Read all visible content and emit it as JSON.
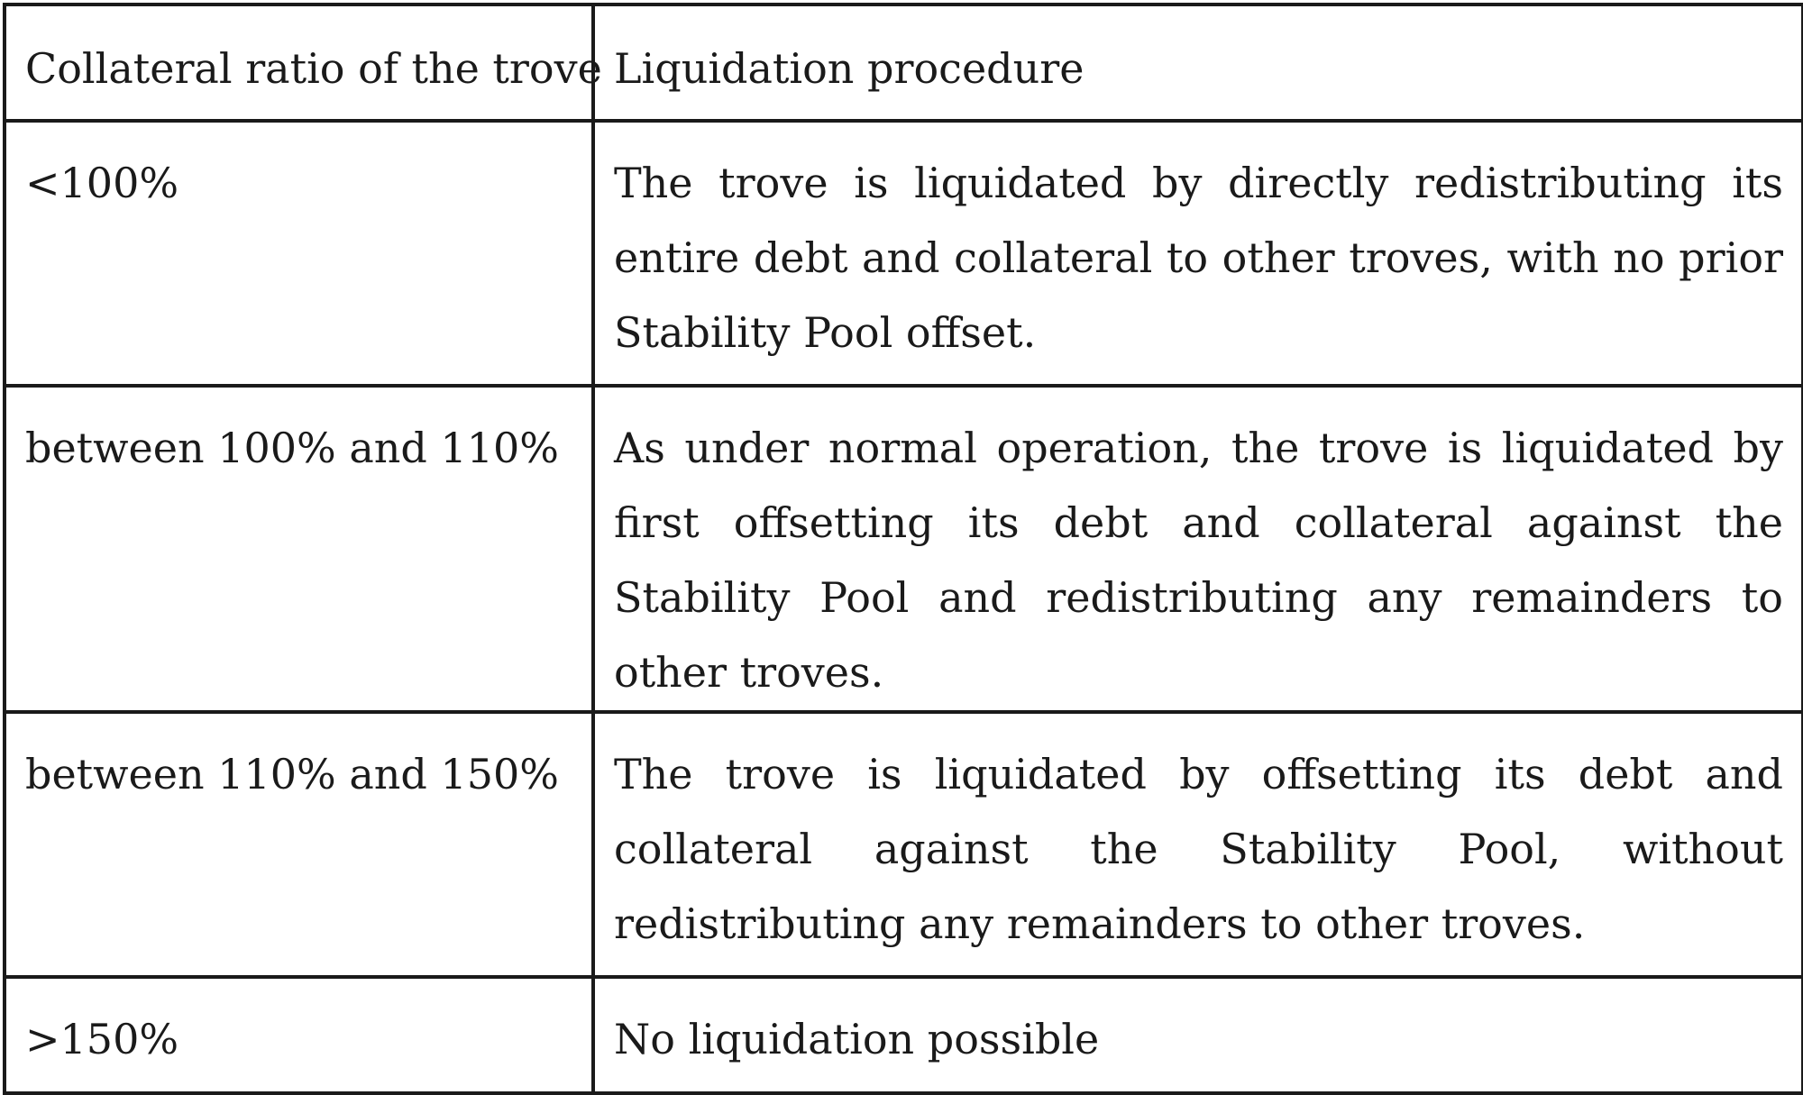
{
  "table": {
    "headers": {
      "ratio": "Collateral ratio of the trove",
      "procedure": "Liquidation procedure"
    },
    "rows": [
      {
        "ratio": "<100%",
        "procedure": "The trove is liquidated by directly redistributing its entire debt and collateral to other troves, with no prior Stability Pool offset."
      },
      {
        "ratio": "between 100% and 110%",
        "procedure": "As under normal operation, the trove is liquidated by first offsetting its debt and collateral against the Stability Pool and redistributing any remainders to other troves."
      },
      {
        "ratio": "between 110% and 150%",
        "procedure": "The trove is liquidated by offsetting its debt and collateral against the Stability Pool, without redistributing any re­mainders to other troves."
      },
      {
        "ratio": ">150%",
        "procedure": "No liquidation possible"
      }
    ]
  }
}
